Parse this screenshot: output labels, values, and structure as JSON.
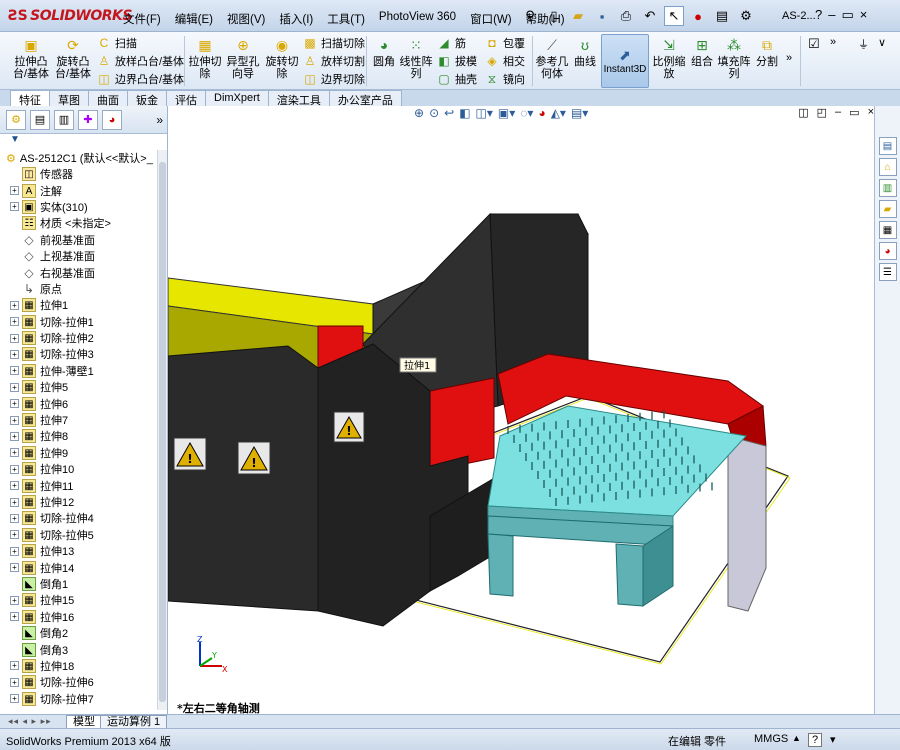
{
  "app": {
    "logo": "SOLIDWORKS",
    "window_title": "AS-2..."
  },
  "menu": [
    "文件(F)",
    "编辑(E)",
    "视图(V)",
    "插入(I)",
    "工具(T)",
    "PhotoView 360",
    "窗口(W)",
    "帮助(H)"
  ],
  "commands": {
    "extrude_boss": "拉伸凸\n台/基体",
    "revolve_boss": "旋转凸\n台/基体",
    "sweep": "扫描",
    "loft_boss": "放样凸台/基体",
    "boundary_boss": "边界凸台/基体",
    "extrude_cut": "拉伸切\n除",
    "hole_wizard": "异型孔\n向导",
    "revolve_cut": "旋转切\n除",
    "swept_cut": "扫描切除",
    "lofted_cut": "放样切割",
    "boundary_cut": "边界切除",
    "fillet": "圆角",
    "linear_pattern": "线性阵\n列",
    "rib": "筋",
    "draft": "拔模",
    "shell": "抽壳",
    "wrap": "包覆",
    "intersect": "相交",
    "mirror": "镜向",
    "ref_geometry": "参考几\n何体",
    "curves": "曲线",
    "instant3d": "Instant3D",
    "scale": "比例缩\n放",
    "combine": "组合",
    "fill_pattern": "填充阵\n列",
    "split": "分割"
  },
  "tabs": [
    "特征",
    "草图",
    "曲面",
    "钣金",
    "评估",
    "DimXpert",
    "渲染工具",
    "办公室产品"
  ],
  "tree": {
    "root": "AS-2512C1 (默认<<默认>_",
    "items": [
      {
        "label": "传感器",
        "expand": false,
        "kind": "sensor"
      },
      {
        "label": "注解",
        "expand": true,
        "kind": "annot"
      },
      {
        "label": "实体(310)",
        "expand": true,
        "kind": "solid"
      },
      {
        "label": "材质 <未指定>",
        "expand": false,
        "kind": "mat"
      },
      {
        "label": "前视基准面",
        "expand": false,
        "kind": "plane"
      },
      {
        "label": "上视基准面",
        "expand": false,
        "kind": "plane"
      },
      {
        "label": "右视基准面",
        "expand": false,
        "kind": "plane"
      },
      {
        "label": "原点",
        "expand": false,
        "kind": "origin"
      },
      {
        "label": "拉伸1",
        "expand": true,
        "kind": "feat"
      },
      {
        "label": "切除-拉伸1",
        "expand": true,
        "kind": "feat"
      },
      {
        "label": "切除-拉伸2",
        "expand": true,
        "kind": "feat"
      },
      {
        "label": "切除-拉伸3",
        "expand": true,
        "kind": "feat"
      },
      {
        "label": "拉伸-薄壁1",
        "expand": true,
        "kind": "feat"
      },
      {
        "label": "拉伸5",
        "expand": true,
        "kind": "feat"
      },
      {
        "label": "拉伸6",
        "expand": true,
        "kind": "feat"
      },
      {
        "label": "拉伸7",
        "expand": true,
        "kind": "feat"
      },
      {
        "label": "拉伸8",
        "expand": true,
        "kind": "feat"
      },
      {
        "label": "拉伸9",
        "expand": true,
        "kind": "feat"
      },
      {
        "label": "拉伸10",
        "expand": true,
        "kind": "feat"
      },
      {
        "label": "拉伸11",
        "expand": true,
        "kind": "feat"
      },
      {
        "label": "拉伸12",
        "expand": true,
        "kind": "feat"
      },
      {
        "label": "切除-拉伸4",
        "expand": true,
        "kind": "feat"
      },
      {
        "label": "切除-拉伸5",
        "expand": true,
        "kind": "feat"
      },
      {
        "label": "拉伸13",
        "expand": true,
        "kind": "feat"
      },
      {
        "label": "拉伸14",
        "expand": true,
        "kind": "feat"
      },
      {
        "label": "倒角1",
        "expand": false,
        "kind": "fillet"
      },
      {
        "label": "拉伸15",
        "expand": true,
        "kind": "feat"
      },
      {
        "label": "拉伸16",
        "expand": true,
        "kind": "feat"
      },
      {
        "label": "倒角2",
        "expand": false,
        "kind": "fillet"
      },
      {
        "label": "倒角3",
        "expand": false,
        "kind": "fillet"
      },
      {
        "label": "拉伸18",
        "expand": true,
        "kind": "feat"
      },
      {
        "label": "切除-拉伸6",
        "expand": true,
        "kind": "feat"
      },
      {
        "label": "切除-拉伸7",
        "expand": true,
        "kind": "feat"
      }
    ]
  },
  "viewport": {
    "view_name": "*左右二等角轴测",
    "tooltip": "拉伸1"
  },
  "sheet_tabs": [
    "模型",
    "运动算例 1"
  ],
  "status": {
    "app_name": "SolidWorks Premium 2013 x64 版",
    "mode": "在编辑 零件",
    "units": "MMGS"
  },
  "colors": {
    "dark_body": "#2b2b2b",
    "red": "#e01010",
    "yellow": "#e6e600",
    "cyan": "#7de0e0",
    "teal": "#5fb1b4",
    "lavender": "#c8c8d8"
  }
}
